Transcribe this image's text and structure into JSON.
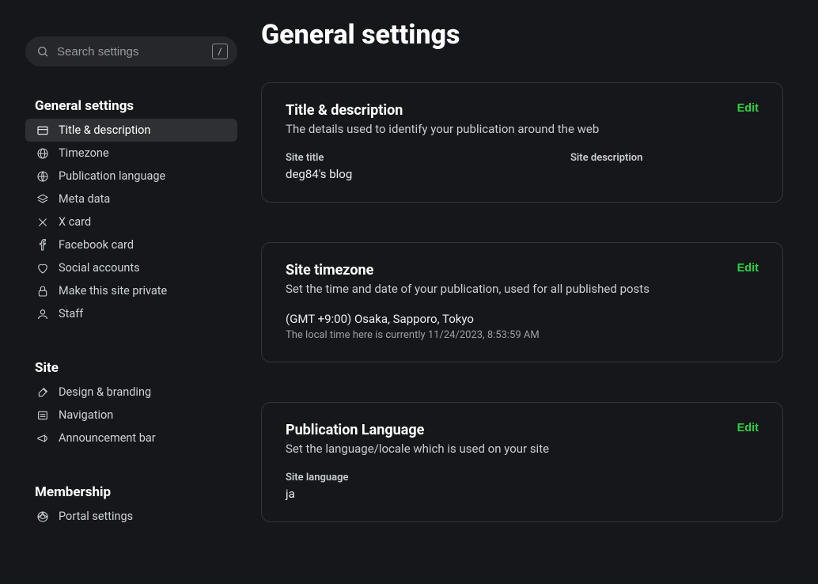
{
  "search": {
    "placeholder": "Search settings",
    "shortcut": "/"
  },
  "sidebar": {
    "sections": [
      {
        "title": "General settings",
        "items": [
          {
            "label": "Title & description",
            "icon": "title-icon",
            "active": true
          },
          {
            "label": "Timezone",
            "icon": "globe-icon"
          },
          {
            "label": "Publication language",
            "icon": "language-icon"
          },
          {
            "label": "Meta data",
            "icon": "stack-icon"
          },
          {
            "label": "X card",
            "icon": "x-icon"
          },
          {
            "label": "Facebook card",
            "icon": "facebook-icon"
          },
          {
            "label": "Social accounts",
            "icon": "heart-icon"
          },
          {
            "label": "Make this site private",
            "icon": "lock-icon"
          },
          {
            "label": "Staff",
            "icon": "user-icon"
          }
        ]
      },
      {
        "title": "Site",
        "items": [
          {
            "label": "Design & branding",
            "icon": "brush-icon"
          },
          {
            "label": "Navigation",
            "icon": "list-icon"
          },
          {
            "label": "Announcement bar",
            "icon": "megaphone-icon"
          }
        ]
      },
      {
        "title": "Membership",
        "items": [
          {
            "label": "Portal settings",
            "icon": "aperture-icon"
          }
        ]
      }
    ]
  },
  "page_title": "General settings",
  "cards": {
    "title_desc": {
      "title": "Title & description",
      "subtitle": "The details used to identify your publication around the web",
      "edit": "Edit",
      "fields": {
        "site_title_label": "Site title",
        "site_title_value": "deg84's blog",
        "site_desc_label": "Site description",
        "site_desc_value": ""
      }
    },
    "timezone": {
      "title": "Site timezone",
      "subtitle": "Set the time and date of your publication, used for all published posts",
      "edit": "Edit",
      "value": "(GMT +9:00) Osaka, Sapporo, Tokyo",
      "helper": "The local time here is currently 11/24/2023, 8:53:59 AM"
    },
    "language": {
      "title": "Publication Language",
      "subtitle": "Set the language/locale which is used on your site",
      "edit": "Edit",
      "field_label": "Site language",
      "field_value": "ja"
    }
  }
}
